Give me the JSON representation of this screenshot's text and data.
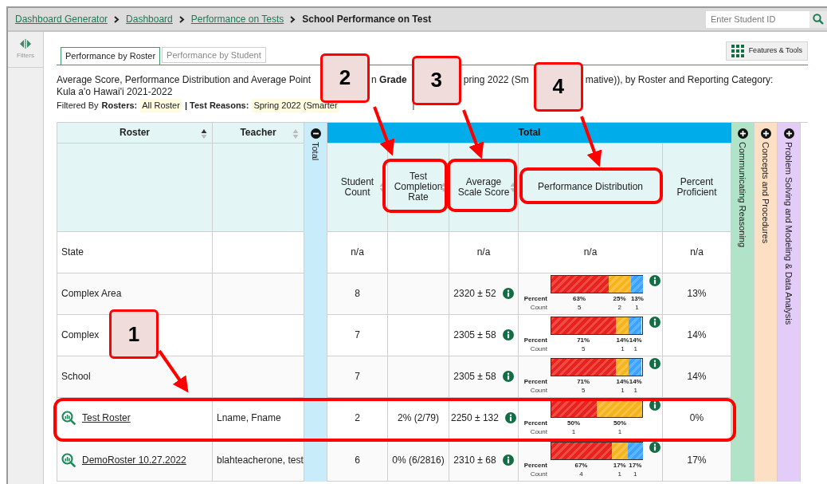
{
  "breadcrumb": [
    {
      "label": "Dashboard Generator",
      "link": true
    },
    {
      "label": "Dashboard",
      "link": true
    },
    {
      "label": "Performance on Tests",
      "link": true
    },
    {
      "label": "School Performance on Test",
      "link": false
    }
  ],
  "student_search": {
    "placeholder": "Enter Student ID"
  },
  "filters_rail": {
    "label": "Filters"
  },
  "tabs": [
    {
      "label": "Performance by Roster",
      "selected": true
    },
    {
      "label": "Performance by Student",
      "selected": false
    }
  ],
  "features_button": {
    "label": "Features & Tools"
  },
  "report_title": {
    "fragments": [
      "Average Score, Performance Distribution and Average Point",
      "n **Grade**",
      "pring 2022 (Sm",
      "mative)), by Roster and Reporting Category:"
    ],
    "line_2": "Kula a'o Hawai'i 2021-2022"
  },
  "filter_line": {
    "prefix": "Filtered By",
    "items": [
      {
        "name": "Rosters:",
        "value": "All Roster"
      },
      {
        "name": "| Test Reasons:",
        "value": "Spring 2022 (Smarter"
      }
    ],
    "suffix": "|"
  },
  "table": {
    "roster_column": {
      "label": "Roster",
      "sorted": true
    },
    "teacher_column": {
      "label": "Teacher",
      "sorted": false
    },
    "total_strip": {
      "label": "Total",
      "expanded": true
    },
    "total_group": {
      "label": "Total"
    },
    "columns": [
      {
        "label": "Student Count",
        "sortable": true,
        "sorted": false
      },
      {
        "label": "Test Completion Rate",
        "sortable": true,
        "sorted": false
      },
      {
        "label": "Average Scale Score",
        "sortable": true,
        "sorted": false
      },
      {
        "label": "Performance Distribution",
        "sortable": false
      },
      {
        "label": "Percent Proficient",
        "sortable": false
      }
    ],
    "category_strips": [
      {
        "label": "Communicating Reasoning",
        "expanded": false,
        "color": "#b0e3c8"
      },
      {
        "label": "Concepts and Procedures",
        "expanded": false,
        "color": "#fde0c3"
      },
      {
        "label": "Problem Solving and Modeling & Data Analysis",
        "expanded": false,
        "color": "#e3ccf8"
      }
    ],
    "rows": [
      {
        "kind": "group",
        "name": "State",
        "student_count": "n/a",
        "avg_score": "n/a",
        "distribution_text": "n/a",
        "proficient": "n/a"
      },
      {
        "kind": "group",
        "name": "Complex Area",
        "student_count": "8",
        "avg_score": "2320 ± 52",
        "distribution": {
          "percent_label": "Percent",
          "count_label": "Count",
          "segments": [
            {
              "percent": "63%",
              "count": "5",
              "color": "#e8231d"
            },
            {
              "percent": "25%",
              "count": "2",
              "color": "#f5b41c"
            },
            {
              "percent": "13%",
              "count": "1",
              "color": "#3aa3ff"
            }
          ]
        },
        "proficient": "13%"
      },
      {
        "kind": "group",
        "name": "Complex",
        "student_count": "7",
        "avg_score": "2305 ± 58",
        "distribution": {
          "percent_label": "Percent",
          "count_label": "Count",
          "segments": [
            {
              "percent": "71%",
              "count": "5",
              "color": "#e8231d"
            },
            {
              "percent": "14%",
              "count": "1",
              "color": "#f5b41c"
            },
            {
              "percent": "14%",
              "count": "1",
              "color": "#3aa3ff"
            }
          ]
        },
        "proficient": "14%"
      },
      {
        "kind": "group",
        "name": "School",
        "student_count": "7",
        "avg_score": "2305 ± 58",
        "distribution": {
          "percent_label": "Percent",
          "count_label": "Count",
          "segments": [
            {
              "percent": "71%",
              "count": "5",
              "color": "#e8231d"
            },
            {
              "percent": "14%",
              "count": "1",
              "color": "#f5b41c"
            },
            {
              "percent": "14%",
              "count": "1",
              "color": "#3aa3ff"
            }
          ]
        },
        "proficient": "14%"
      },
      {
        "kind": "roster",
        "name": "Test Roster",
        "teacher": "Lname, Fname",
        "student_count": "2",
        "completion": "2% (2/79)",
        "avg_score": "2250 ± 132",
        "distribution": {
          "percent_label": "Percent",
          "count_label": "Count",
          "segments": [
            {
              "percent": "50%",
              "count": "1",
              "color": "#e8231d"
            },
            {
              "percent": "50%",
              "count": "1",
              "color": "#f5b41c"
            }
          ]
        },
        "proficient": "0%"
      },
      {
        "kind": "roster",
        "name": "DemoRoster 10.27.2022",
        "teacher": "blahteacherone, test",
        "student_count": "6",
        "completion": "0% (6/2816)",
        "avg_score": "2310 ± 68",
        "distribution": {
          "percent_label": "Percent",
          "count_label": "Count",
          "segments": [
            {
              "percent": "67%",
              "count": "4",
              "color": "#e8231d"
            },
            {
              "percent": "17%",
              "count": "1",
              "color": "#f5b41c"
            },
            {
              "percent": "17%",
              "count": "1",
              "color": "#3aa3ff"
            }
          ]
        },
        "proficient": "17%"
      }
    ]
  },
  "callouts": [
    {
      "label": "1"
    },
    {
      "label": "2"
    },
    {
      "label": "3"
    },
    {
      "label": "4"
    }
  ]
}
